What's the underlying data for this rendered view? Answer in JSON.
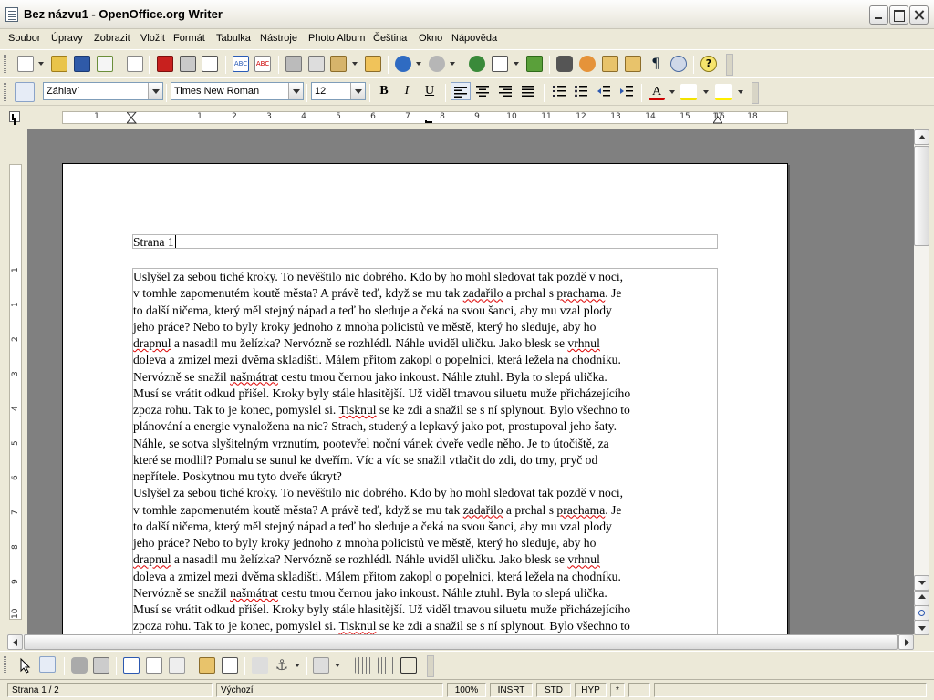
{
  "window": {
    "title": "Bez názvu1 - OpenOffice.org Writer"
  },
  "menu": [
    "Soubor",
    "Úpravy",
    "Zobrazit",
    "Vložit",
    "Formát",
    "Tabulka",
    "Nástroje",
    "Photo Album",
    "Čeština",
    "Okno",
    "Nápověda"
  ],
  "formatting": {
    "style": "Záhlaví",
    "font": "Times New Roman",
    "size": "12",
    "bold": "B",
    "italic": "I",
    "underline": "U"
  },
  "ruler": {
    "numbers": [
      "1",
      "1",
      "2",
      "3",
      "4",
      "5",
      "6",
      "7",
      "8",
      "9",
      "10",
      "11",
      "12",
      "13",
      "14",
      "15",
      "16",
      "17",
      "18"
    ],
    "vnumbers": [
      "1",
      "1",
      "2",
      "3",
      "4",
      "5",
      "6",
      "7",
      "8",
      "9",
      "10",
      "11"
    ]
  },
  "document": {
    "header_text": "Strana 1",
    "body_lines": [
      "Uslyšel za sebou tiché kroky. To nevěštilo nic dobrého. Kdo by ho mohl sledovat tak pozdě v noci,",
      "v tomhle zapomenutém koutě města? A právě teď, když se mu tak zadařilo a prchal s prachama. Je",
      "to další ničema, který měl stejný nápad a teď ho sleduje a čeká na svou šanci, aby mu vzal plody",
      "jeho práce? Nebo to byly kroky jednoho z mnoha policistů ve městě, který ho sleduje, aby ho",
      "drapnul a nasadil mu želízka? Nervózně se rozhlédl. Náhle uviděl uličku. Jako blesk se vrhnul",
      "doleva a zmizel mezi dvěma skladišti. Málem přitom zakopl o popelnici, která ležela na chodníku.",
      "Nervózně se snažil našmátrat cestu tmou černou jako inkoust. Náhle ztuhl. Byla to slepá ulička.",
      "Musí se vrátit odkud přišel. Kroky byly stále hlasitější. Už viděl tmavou siluetu muže přicházejícího",
      "zpoza rohu. Tak to je konec, pomyslel si. Tisknul se ke zdi a snažil se s ní splynout. Bylo všechno to",
      "plánování a energie vynaložena na nic? Strach, studený a lepkavý jako pot, prostupoval jeho šaty.",
      "Náhle, se sotva slyšitelným vrznutím, pootevřel noční vánek dveře vedle něho. Je to útočiště, za",
      "které se modlil? Pomalu se sunul ke dveřím. Víc a víc se snažil vtlačit do zdi, do tmy, pryč od",
      "nepřítele. Poskytnou mu tyto dveře úkryt?",
      "Uslyšel za sebou tiché kroky. To nevěštilo nic dobrého. Kdo by ho mohl sledovat tak pozdě v noci,",
      "v tomhle zapomenutém koutě města? A právě teď, když se mu tak zadařilo a prchal s prachama. Je",
      "to další ničema, který měl stejný nápad a teď ho sleduje a čeká na svou šanci, aby mu vzal plody",
      "jeho práce? Nebo to byly kroky jednoho z mnoha policistů ve městě, který ho sleduje, aby ho",
      "drapnul a nasadil mu želízka? Nervózně se rozhlédl. Náhle uviděl uličku. Jako blesk se vrhnul",
      "doleva a zmizel mezi dvěma skladišti. Málem přitom zakopl o popelnici, která ležela na chodníku.",
      "Nervózně se snažil našmátrat cestu tmou černou jako inkoust. Náhle ztuhl. Byla to slepá ulička.",
      "Musí se vrátit odkud přišel. Kroky byly stále hlasitější. Už viděl tmavou siluetu muže přicházejícího",
      "zpoza rohu. Tak to je konec, pomyslel si. Tisknul se ke zdi a snažil se s ní splynout. Bylo všechno to"
    ],
    "misspelled": [
      "zadařilo",
      "prachama",
      "drapnul",
      "vrhnul",
      "našmátrat",
      "Tisknul"
    ]
  },
  "status": {
    "page": "Strana 1 / 2",
    "style": "Výchozí",
    "zoom": "100%",
    "insert": "INSRT",
    "selection": "STD",
    "hyperlink": "HYP",
    "modified": "*"
  }
}
